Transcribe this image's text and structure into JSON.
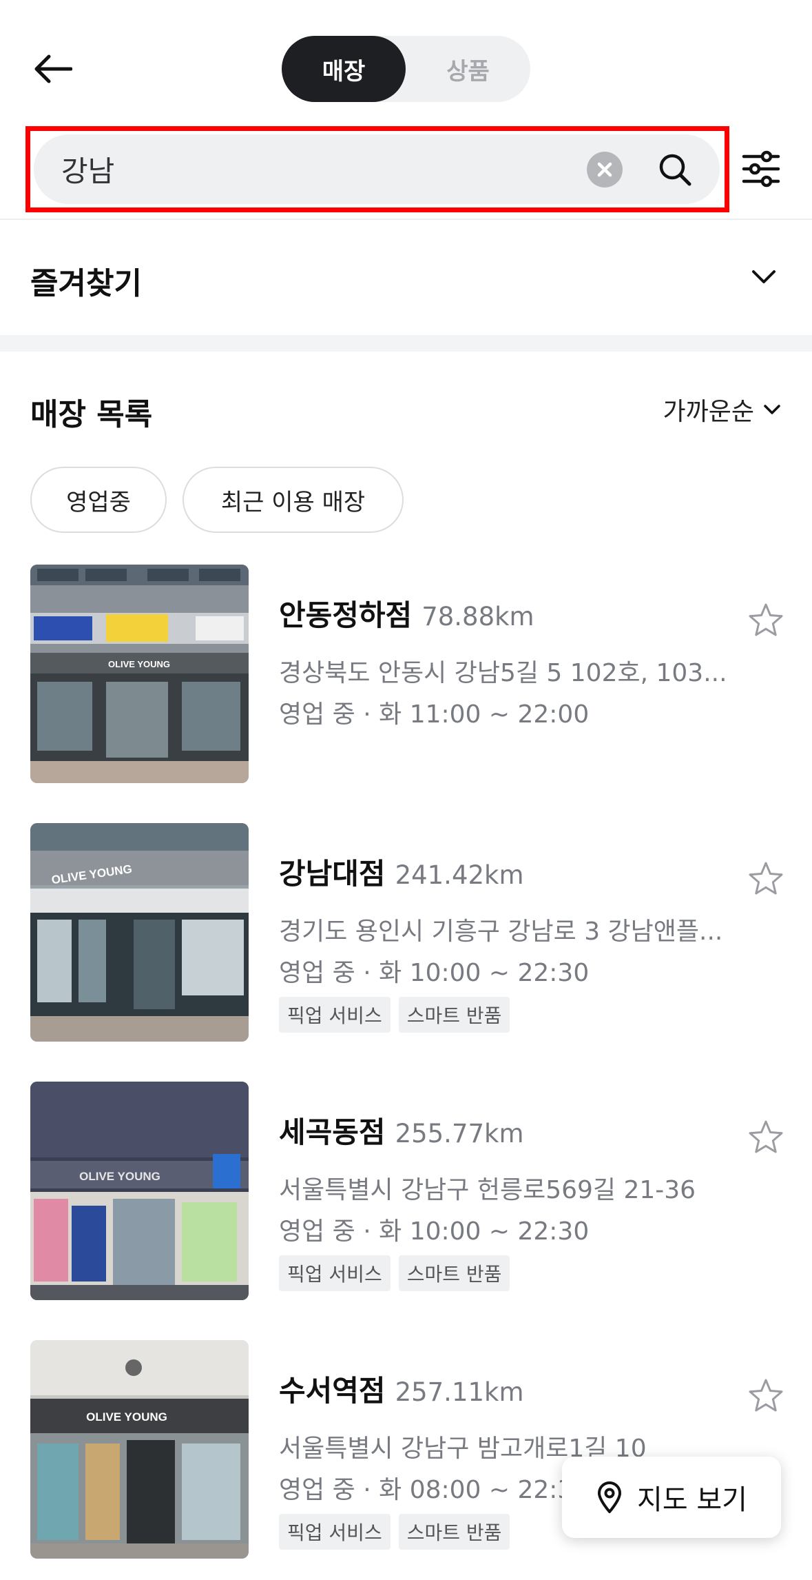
{
  "header": {
    "tabs": [
      "매장",
      "상품"
    ],
    "active_tab": "매장"
  },
  "search": {
    "value": "강남",
    "placeholder": ""
  },
  "favorites": {
    "title": "즐겨찾기"
  },
  "store_list": {
    "title": "매장 목록",
    "sort_label": "가까운순",
    "chips": [
      "영업중",
      "최근 이용 매장"
    ],
    "stores": [
      {
        "name": "안동정하점",
        "distance": "78.88km",
        "address": "경상북도 안동시 강남5길 5 102호, 103...",
        "hours": "영업 중 · 화 11:00 ~ 22:00",
        "tags": [],
        "logo_text": "OLIVE YOUNG"
      },
      {
        "name": "강남대점",
        "distance": "241.42km",
        "address": "경기도 용인시 기흥구 강남로 3 강남앤플...",
        "hours": "영업 중 · 화 10:00 ~ 22:30",
        "tags": [
          "픽업 서비스",
          "스마트 반품"
        ],
        "logo_text": "OLIVE YOUNG"
      },
      {
        "name": "세곡동점",
        "distance": "255.77km",
        "address": "서울특별시 강남구 헌릉로569길 21-36",
        "hours": "영업 중 · 화 10:00 ~ 22:30",
        "tags": [
          "픽업 서비스",
          "스마트 반품"
        ],
        "logo_text": "OLIVE YOUNG"
      },
      {
        "name": "수서역점",
        "distance": "257.11km",
        "address": "서울특별시 강남구 밤고개로1길 10",
        "hours": "영업 중 · 화 08:00 ~ 22:30",
        "tags": [
          "픽업 서비스",
          "스마트 반품"
        ],
        "logo_text": "OLIVE YOUNG"
      }
    ]
  },
  "map_button": {
    "label": "지도 보기"
  },
  "icons": {
    "back": "arrow-left-icon",
    "clear": "clear-x-icon",
    "search": "search-icon",
    "filter": "sliders-icon",
    "chevron": "chevron-down-icon",
    "star": "star-outline-icon",
    "pin": "map-pin-icon"
  }
}
